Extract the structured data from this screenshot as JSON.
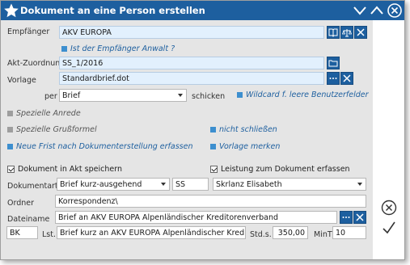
{
  "window": {
    "title": "Dokument an eine Person erstellen"
  },
  "colors": {
    "titlebar": "#1d5f9f",
    "form_bg": "#e5e5e5",
    "highlight_field": "#e2f0fd",
    "checkbox_on": "#3d8fcf"
  },
  "empfaenger": {
    "label": "Empfänger",
    "value": "AKV EUROPA",
    "anwalt_label": "Ist der Empfänger Anwalt ?"
  },
  "akt": {
    "label": "Akt-Zuordnung",
    "value": "SS_1/2016"
  },
  "vorlage": {
    "label": "Vorlage",
    "value": "Standardbrief.dot"
  },
  "per": {
    "label": "per",
    "value": "Brief",
    "schicken_label": "schicken",
    "wildcard_label": "Wildcard f. leere Benutzerfelder"
  },
  "options": {
    "spezielle_anrede": "Spezielle Anrede",
    "spezielle_grussformel": "Spezielle Grußformel",
    "nicht_schliessen": "nicht schließen",
    "neue_frist": "Neue Frist nach Dokumenterstellung erfassen",
    "vorlage_merken": "Vorlage merken",
    "dokument_speichern": "Dokument in Akt speichern",
    "leistung_erfassen": "Leistung zum Dokument erfassen"
  },
  "dokumentart": {
    "label": "Dokumentart",
    "value": "Brief kurz-ausgehend",
    "short": "SS",
    "person": "Skrlanz Elisabeth"
  },
  "ordner": {
    "label": "Ordner",
    "value": "Korrespondenz\\"
  },
  "dateiname": {
    "label": "Dateiname",
    "value": "Brief an AKV EUROPA Alpenländischer Kreditorenverband"
  },
  "leistung": {
    "code": "BK",
    "lst_label": "Lst.",
    "text": "Brief kurz an AKV EUROPA Alpenländischer Kreditorenver",
    "stds_label": "Std.s.",
    "stds_value": "350,00",
    "mint_label": "MinT",
    "mint_value": "10"
  },
  "icons": [
    "star-icon",
    "minimize-icon",
    "maximize-icon",
    "close-icon",
    "book-icon",
    "scales-icon",
    "clear-icon",
    "folder-icon",
    "ellipsis-icon",
    "cancel-icon",
    "confirm-icon"
  ]
}
